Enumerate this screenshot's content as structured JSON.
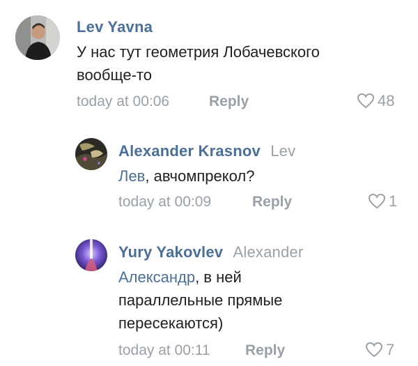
{
  "comments": [
    {
      "author": "Lev Yavna",
      "reply_to": "",
      "mention": "",
      "text_lines": [
        "У нас тут геометрия Лобачевского",
        "вообще-то"
      ],
      "time": "today at 00:06",
      "reply_label": "Reply",
      "likes": "48",
      "avatar_icon": "user-photo-avatar"
    },
    {
      "author": "Alexander Krasnov",
      "reply_to": "Lev",
      "mention": "Лев",
      "text_after_mention": ", авчомпрекол?",
      "time": "today at 00:09",
      "reply_label": "Reply",
      "likes": "1",
      "avatar_icon": "user-photo-avatar"
    },
    {
      "author": "Yury Yakovlev",
      "reply_to": "Alexander",
      "mention": "Александр",
      "text_after_mention": ", в ней",
      "text_more_lines": [
        "параллельные прямые",
        "пересекаются)"
      ],
      "time": "today at 00:11",
      "reply_label": "Reply",
      "likes": "7",
      "avatar_icon": "user-photo-avatar"
    }
  ],
  "colors": {
    "accent": "#4a6f9a",
    "muted": "#9aa0a8",
    "text": "#1f1f1f"
  }
}
